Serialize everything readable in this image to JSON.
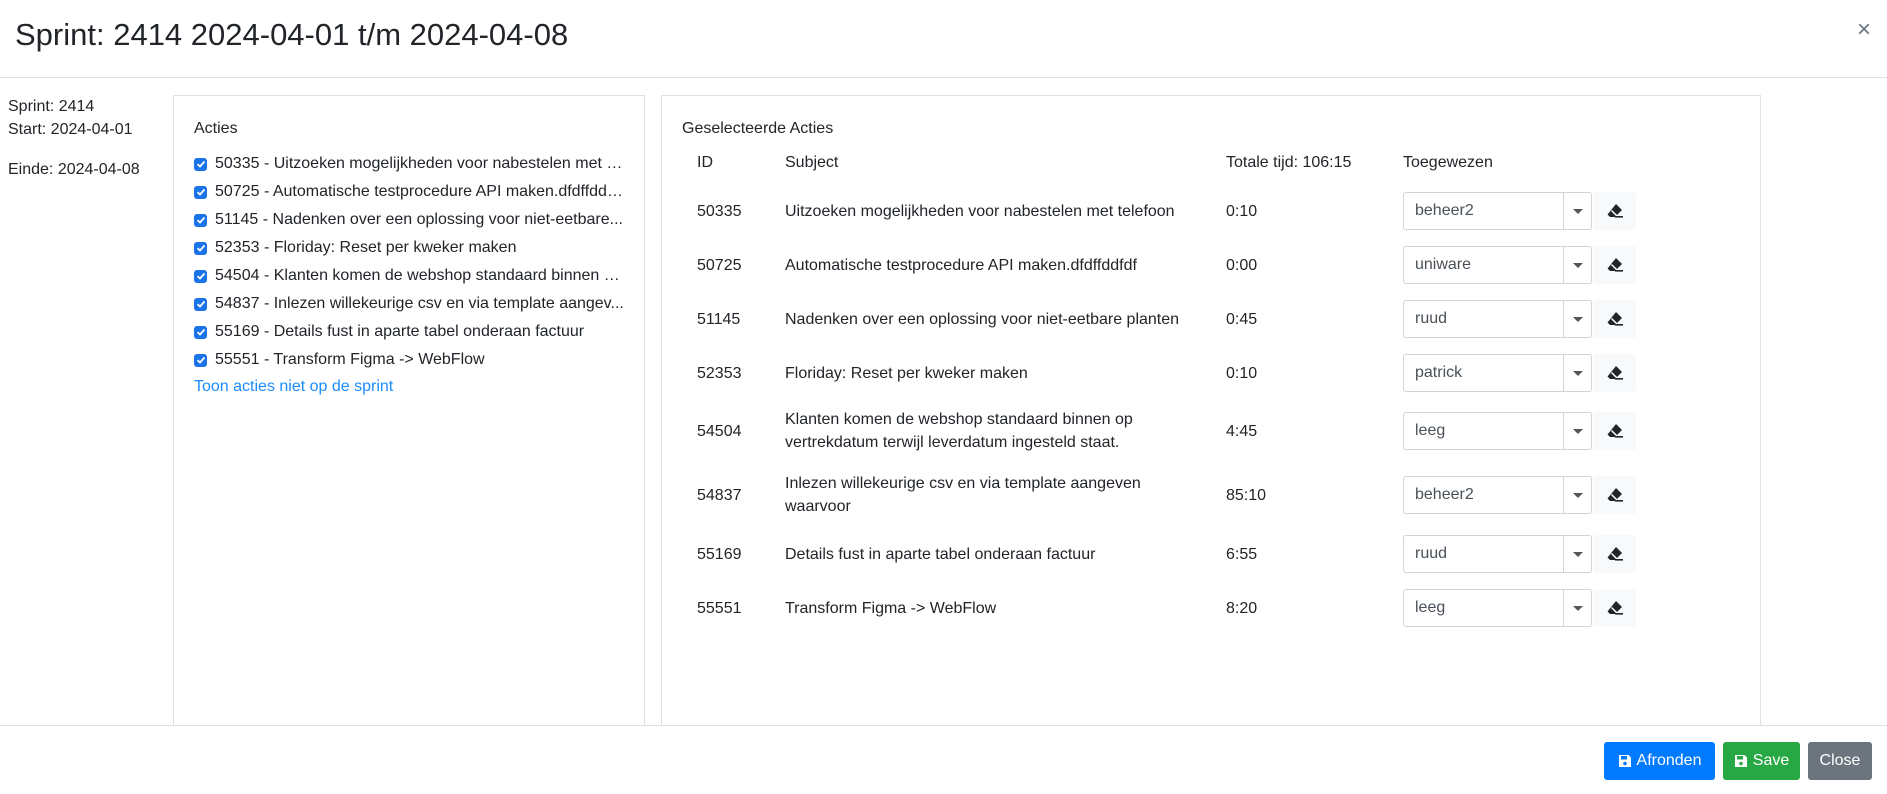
{
  "header": {
    "title": "Sprint: 2414 2024-04-01 t/m 2024-04-08",
    "close_glyph": "×"
  },
  "info": {
    "sprint": "Sprint: 2414",
    "start": "Start: 2024-04-01",
    "einde": "Einde: 2024-04-08"
  },
  "left_panel": {
    "heading": "Acties",
    "actions": [
      {
        "text": "50335 - Uitzoeken mogelijkheden voor nabestelen met t...",
        "checked": true
      },
      {
        "text": "50725 - Automatische testprocedure API maken.dfdffddf...",
        "checked": true
      },
      {
        "text": "51145 - Nadenken over een oplossing voor niet-eetbare...",
        "checked": true
      },
      {
        "text": "52353 - Floriday: Reset per kweker maken",
        "checked": true
      },
      {
        "text": "54504 - Klanten komen de webshop standaard binnen o...",
        "checked": true
      },
      {
        "text": "54837 - Inlezen willekeurige csv en via template aangev...",
        "checked": true
      },
      {
        "text": "55169 - Details fust in aparte tabel onderaan factuur",
        "checked": true
      },
      {
        "text": "55551 - Transform Figma -> WebFlow",
        "checked": true
      }
    ],
    "link": "Toon acties niet op de sprint"
  },
  "right_panel": {
    "heading": "Geselecteerde Acties",
    "columns": {
      "id": "ID",
      "subject": "Subject",
      "time": "Totale tijd: 106:15",
      "assigned": "Toegewezen"
    },
    "rows": [
      {
        "id": "50335",
        "subject": "Uitzoeken mogelijkheden voor nabestelen met telefoon",
        "subject2": "",
        "time": "0:10",
        "assigned": "beheer2"
      },
      {
        "id": "50725",
        "subject": "Automatische testprocedure API maken.dfdffddfdf",
        "subject2": "",
        "time": "0:00",
        "assigned": "uniware"
      },
      {
        "id": "51145",
        "subject": "Nadenken over een oplossing voor niet-eetbare planten",
        "subject2": "",
        "time": "0:45",
        "assigned": "ruud"
      },
      {
        "id": "52353",
        "subject": "Floriday: Reset per kweker maken",
        "subject2": "",
        "time": "0:10",
        "assigned": "patrick"
      },
      {
        "id": "54504",
        "subject": "Klanten komen de webshop standaard binnen op",
        "subject2": "vertrekdatum terwijl leverdatum ingesteld staat.",
        "time": "4:45",
        "assigned": "leeg"
      },
      {
        "id": "54837",
        "subject": "Inlezen willekeurige csv en via template aangeven",
        "subject2": "waarvoor",
        "time": "85:10",
        "assigned": "beheer2"
      },
      {
        "id": "55169",
        "subject": "Details fust in aparte tabel onderaan factuur",
        "subject2": "",
        "time": "6:55",
        "assigned": "ruud"
      },
      {
        "id": "55551",
        "subject": "Transform Figma -> WebFlow",
        "subject2": "",
        "time": "8:20",
        "assigned": "leeg"
      }
    ]
  },
  "footer": {
    "afronden": "Afronden",
    "save": "Save",
    "close": "Close"
  },
  "colors": {
    "primary": "#007bff",
    "success": "#28a745",
    "secondary": "#6c757d",
    "checkbox": "#1a73e8",
    "link": "#1a8cff"
  },
  "icons": [
    "close-icon",
    "checkbox-checked-icon",
    "chevron-down-icon",
    "eraser-icon",
    "save-icon"
  ]
}
